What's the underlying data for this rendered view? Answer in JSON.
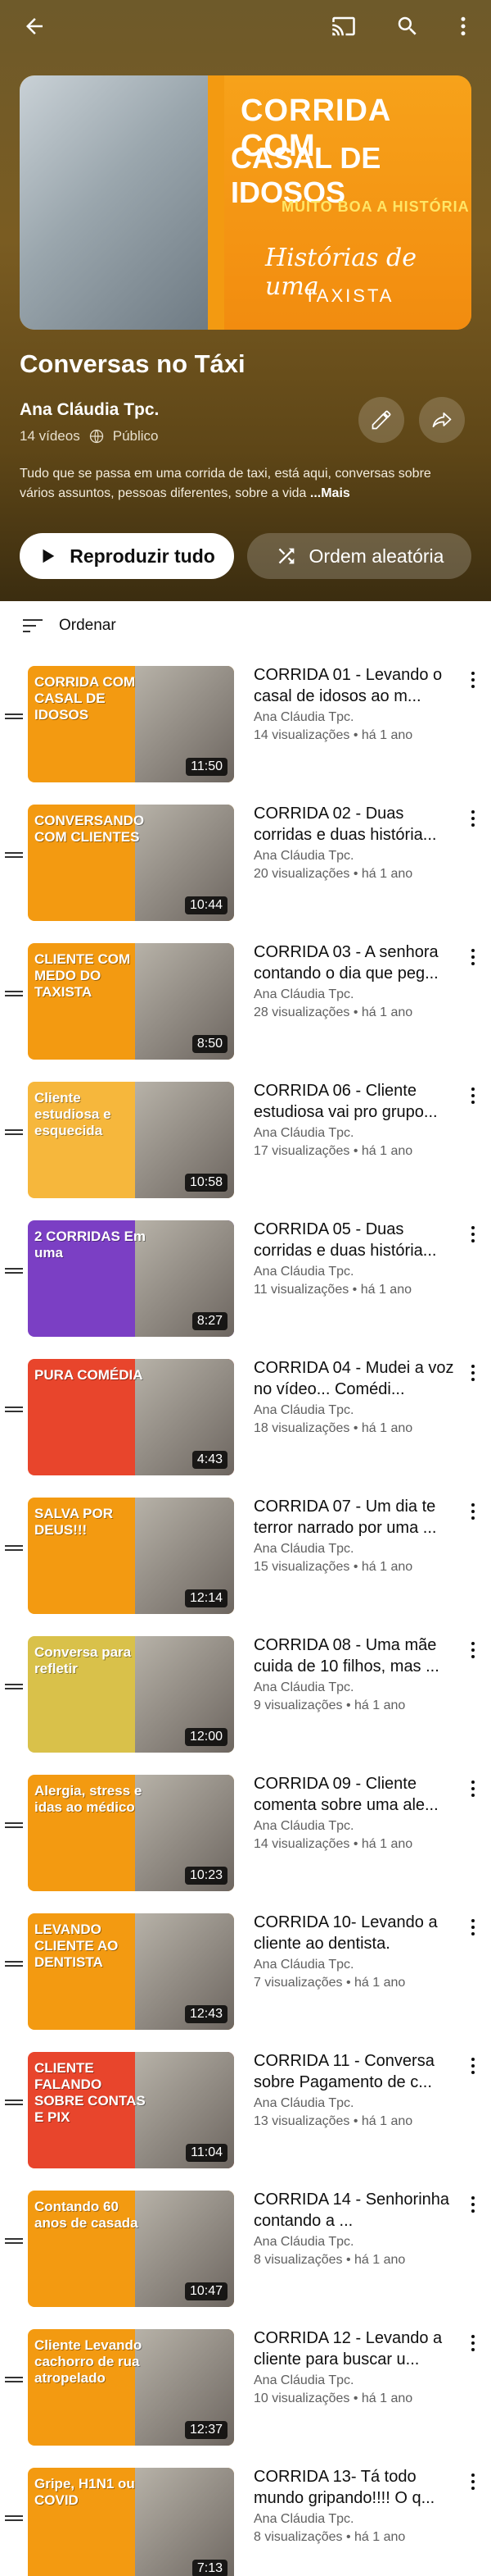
{
  "header": {
    "back_icon": "arrow-left-icon",
    "cast_icon": "cast-icon",
    "search_icon": "search-icon",
    "more_icon": "more-vert-icon"
  },
  "cover": {
    "line1": "CORRIDA COM",
    "line2": "CASAL DE IDOSOS",
    "line3": "MUITO BOA A HISTÓRIA",
    "line4": "Histórias de uma",
    "line5": "TAXISTA"
  },
  "playlist": {
    "title": "Conversas no Táxi",
    "owner": "Ana Cláudia Tpc.",
    "video_count": "14 vídeos",
    "visibility": "Público",
    "description": "Tudo que se passa em uma corrida de taxi, está aqui, conversas sobre vários assuntos, pessoas diferentes, sobre a vida",
    "more_label": "...Mais",
    "play_all_label": "Reproduzir tudo",
    "shuffle_label": "Ordem aleatória",
    "sort_label": "Ordenar"
  },
  "colors": {
    "accent_orange": "#f39a11",
    "hero_bg": "#6e5a2a"
  },
  "videos": [
    {
      "title": "CORRIDA 01 - Levando o casal de idosos ao m...",
      "channel": "Ana Cláudia Tpc.",
      "stats": "14 visualizações • há 1 ano",
      "duration": "11:50",
      "thumb_text": "CORRIDA COM CASAL DE IDOSOS",
      "thumb_color": "#f39a11"
    },
    {
      "title": "CORRIDA 02 - Duas corridas e duas história...",
      "channel": "Ana Cláudia Tpc.",
      "stats": "20 visualizações • há 1 ano",
      "duration": "10:44",
      "thumb_text": "CONVERSANDO COM CLIENTES",
      "thumb_color": "#f39a11"
    },
    {
      "title": "CORRIDA 03 - A senhora contando o dia que peg...",
      "channel": "Ana Cláudia Tpc.",
      "stats": "28 visualizações • há 1 ano",
      "duration": "8:50",
      "thumb_text": "CLIENTE COM MEDO DO TAXISTA",
      "thumb_color": "#f39a11"
    },
    {
      "title": "CORRIDA 06 - Cliente estudiosa vai pro grupo...",
      "channel": "Ana Cláudia Tpc.",
      "stats": "17 visualizações • há 1 ano",
      "duration": "10:58",
      "thumb_text": "Cliente estudiosa e esquecida",
      "thumb_color": "#f6b73c"
    },
    {
      "title": "CORRIDA 05 - Duas corridas e duas história...",
      "channel": "Ana Cláudia Tpc.",
      "stats": "11 visualizações • há 1 ano",
      "duration": "8:27",
      "thumb_text": "2 CORRIDAS Em uma",
      "thumb_color": "#7b3fc4"
    },
    {
      "title": "CORRIDA 04 - Mudei a voz no vídeo... Comédi...",
      "channel": "Ana Cláudia Tpc.",
      "stats": "18 visualizações • há 1 ano",
      "duration": "4:43",
      "thumb_text": "PURA COMÉDIA",
      "thumb_color": "#e8452c"
    },
    {
      "title": "CORRIDA 07 - Um dia te terror narrado por uma ...",
      "channel": "Ana Cláudia Tpc.",
      "stats": "15 visualizações • há 1 ano",
      "duration": "12:14",
      "thumb_text": "SALVA POR DEUS!!!",
      "thumb_color": "#f39a11"
    },
    {
      "title": "CORRIDA 08 - Uma mãe cuida de 10 filhos, mas ...",
      "channel": "Ana Cláudia Tpc.",
      "stats": "9 visualizações • há 1 ano",
      "duration": "12:00",
      "thumb_text": "Conversa para refletir",
      "thumb_color": "#d9c14a"
    },
    {
      "title": "CORRIDA 09 - Cliente comenta sobre uma ale...",
      "channel": "Ana Cláudia Tpc.",
      "stats": "14 visualizações • há 1 ano",
      "duration": "10:23",
      "thumb_text": "Alergia, stress e idas ao médico",
      "thumb_color": "#f39a11"
    },
    {
      "title": "CORRIDA 10- Levando a cliente ao dentista.",
      "channel": "Ana Cláudia Tpc.",
      "stats": "7 visualizações • há 1 ano",
      "duration": "12:43",
      "thumb_text": "LEVANDO CLIENTE AO DENTISTA",
      "thumb_color": "#f39a11"
    },
    {
      "title": "CORRIDA 11 - Conversa sobre Pagamento de c...",
      "channel": "Ana Cláudia Tpc.",
      "stats": "13 visualizações • há 1 ano",
      "duration": "11:04",
      "thumb_text": "CLIENTE FALANDO SOBRE CONTAS E PIX",
      "thumb_color": "#e8452c"
    },
    {
      "title": "CORRIDA 14 - Senhorinha contando a ...",
      "channel": "Ana Cláudia Tpc.",
      "stats": "8 visualizações • há 1 ano",
      "duration": "10:47",
      "thumb_text": "Contando 60 anos de casada",
      "thumb_color": "#f39a11"
    },
    {
      "title": "CORRIDA 12 - Levando a cliente para buscar u...",
      "channel": "Ana Cláudia Tpc.",
      "stats": "10 visualizações • há 1 ano",
      "duration": "12:37",
      "thumb_text": "Cliente Levando cachorro de rua atropelado",
      "thumb_color": "#f39a11"
    },
    {
      "title": "CORRIDA 13- Tá todo mundo gripando!!!! O q...",
      "channel": "Ana Cláudia Tpc.",
      "stats": "8 visualizações • há 1 ano",
      "duration": "7:13",
      "thumb_text": "Gripe, H1N1 ou COVID",
      "thumb_color": "#f39a11"
    }
  ]
}
